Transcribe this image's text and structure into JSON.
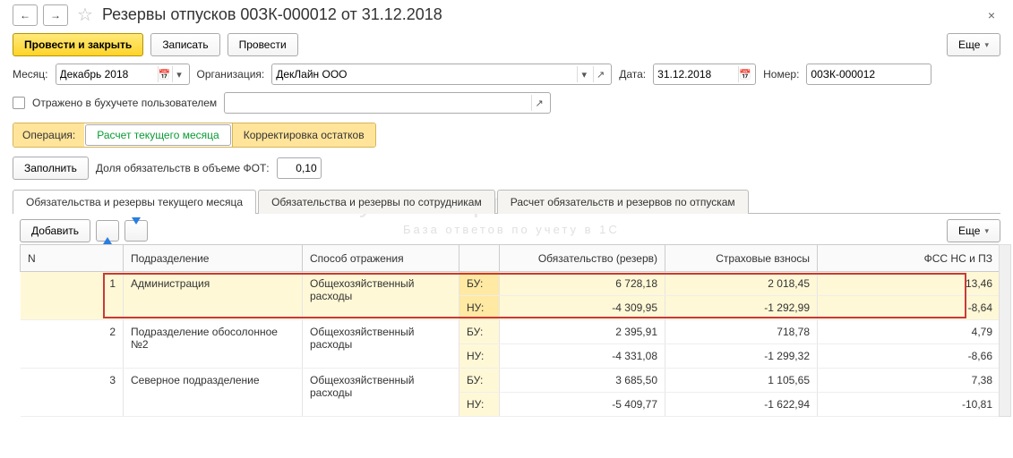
{
  "title": "Резервы отпусков  00ЗК-000012 от 31.12.2018",
  "buttons": {
    "post_close": "Провести и закрыть",
    "write": "Записать",
    "post": "Провести",
    "more": "Еще",
    "fill": "Заполнить",
    "add": "Добавить"
  },
  "fields": {
    "month_label": "Месяц:",
    "month_value": "Декабрь 2018",
    "org_label": "Организация:",
    "org_value": "ДекЛайн ООО",
    "date_label": "Дата:",
    "date_value": "31.12.2018",
    "number_label": "Номер:",
    "number_value": "00ЗК-000012",
    "reflected_label": "Отражено в бухучете пользователем",
    "oper_label": "Операция:",
    "oper_tab1": "Расчет текущего месяца",
    "oper_tab2": "Корректировка остатков",
    "share_label": "Доля обязательств в объеме ФОТ:",
    "share_value": "0,10"
  },
  "tabs": {
    "t1": "Обязательства и резервы текущего месяца",
    "t2": "Обязательства и резервы по сотрудникам",
    "t3": "Расчет обязательств и резервов по отпускам"
  },
  "columns": {
    "n": "N",
    "dept": "Подразделение",
    "method": "Способ отражения",
    "acc": "",
    "liab": "Обязательство (резерв)",
    "ins": "Страховые взносы",
    "fss": "ФСС НС и ПЗ"
  },
  "rows": [
    {
      "n": "1",
      "dept": "Администрация",
      "method": "Общехозяйственный расходы",
      "bu": {
        "label": "БУ:",
        "liab": "6 728,18",
        "ins": "2 018,45",
        "fss": "13,46"
      },
      "nu": {
        "label": "НУ:",
        "liab": "-4 309,95",
        "ins": "-1 292,99",
        "fss": "-8,64"
      }
    },
    {
      "n": "2",
      "dept": "Подразделение обосолонное №2",
      "method": "Общехозяйственный расходы",
      "bu": {
        "label": "БУ:",
        "liab": "2 395,91",
        "ins": "718,78",
        "fss": "4,79"
      },
      "nu": {
        "label": "НУ:",
        "liab": "-4 331,08",
        "ins": "-1 299,32",
        "fss": "-8,66"
      }
    },
    {
      "n": "3",
      "dept": "Северное подразделение",
      "method": "Общехозяйственный расходы",
      "bu": {
        "label": "БУ:",
        "liab": "3 685,50",
        "ins": "1 105,65",
        "fss": "7,38"
      },
      "nu": {
        "label": "НУ:",
        "liab": "-5 409,77",
        "ins": "-1 622,94",
        "fss": "-10,81"
      }
    }
  ],
  "watermark": {
    "l1": "БухЭксперт",
    "l2": "База ответов по учету в 1С"
  }
}
